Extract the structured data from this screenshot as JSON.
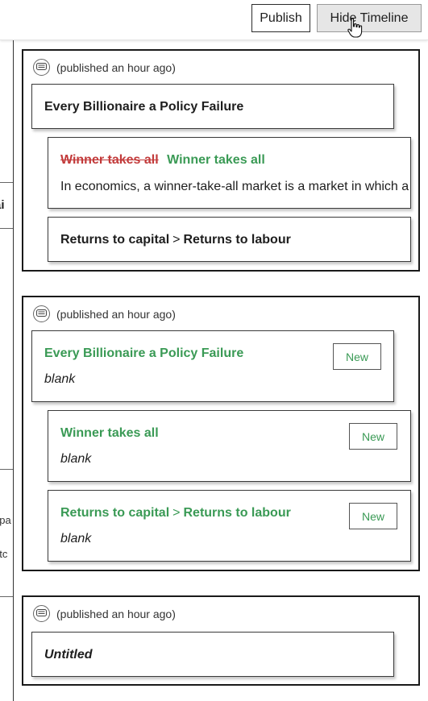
{
  "toolbar": {
    "publish_label": "Publish",
    "hide_timeline_label": "Hide Timeline"
  },
  "left_panel": {
    "fragment_1": "tai",
    "fragment_2": "npa",
    "fragment_3": "utc"
  },
  "timeline": [
    {
      "published": "(published an hour ago)",
      "root": {
        "title": "Every Billionaire a Policy Failure"
      },
      "children": [
        {
          "old_title": "Winner takes all",
          "new_title": "Winner takes all",
          "description": "In economics, a winner-take-all market is a market in which a product"
        },
        {
          "title_left": "Returns to capital",
          "separator": ">",
          "title_right": "Returns to labour"
        }
      ]
    },
    {
      "published": "(published an hour ago)",
      "root": {
        "title": "Every Billionaire a Policy Failure",
        "body": "blank",
        "badge": "New"
      },
      "children": [
        {
          "title": "Winner takes all",
          "body": "blank",
          "badge": "New"
        },
        {
          "title_left": "Returns to capital",
          "separator": ">",
          "title_right": "Returns to labour",
          "body": "blank",
          "badge": "New"
        }
      ]
    },
    {
      "published": "(published an hour ago)",
      "root": {
        "title": "Untitled"
      }
    }
  ],
  "colors": {
    "added_green": "#3a9a55",
    "removed_red": "#c23a3a",
    "border": "#1a1a1a"
  },
  "icons": {
    "card_icon": "chat-bubble-icon",
    "pointer": "hand-pointer-icon"
  }
}
